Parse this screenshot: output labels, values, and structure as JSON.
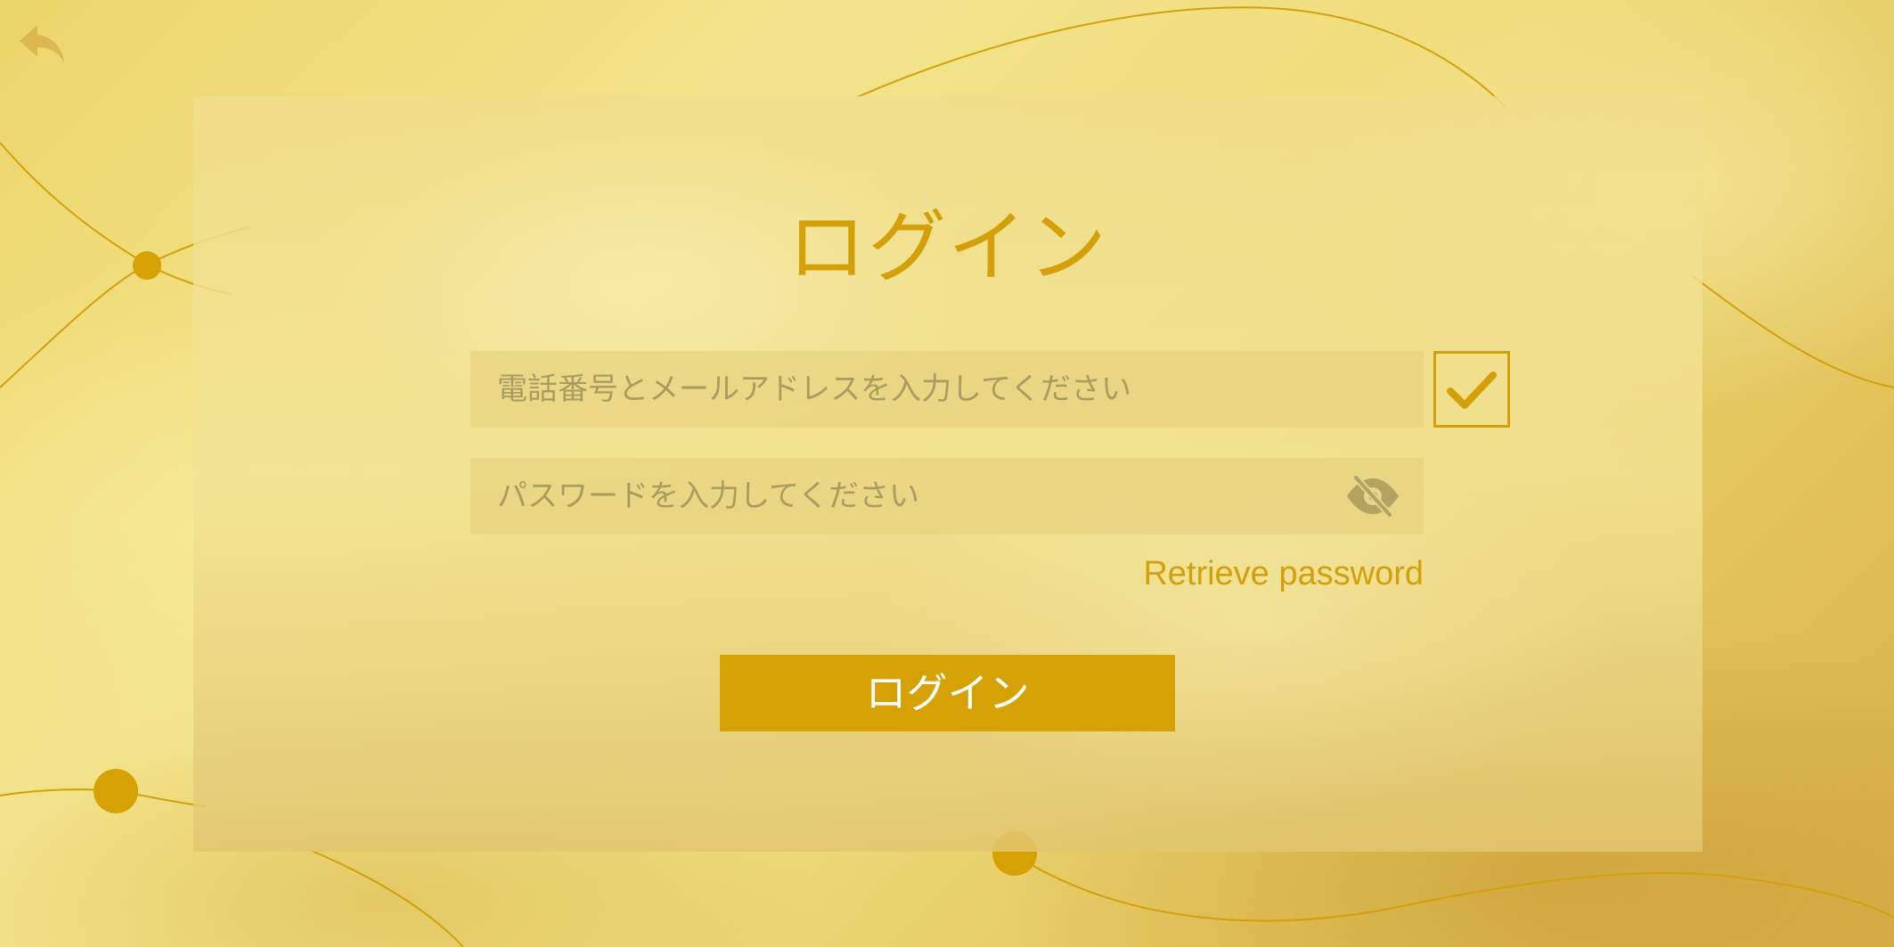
{
  "theme": {
    "accent_color": "#d4a00a",
    "button_color": "#d6a105",
    "button_text_color": "#ffffff"
  },
  "nav": {
    "back_icon": "back-arrow-icon"
  },
  "login": {
    "title": "ログイン",
    "account_placeholder": "電話番号とメールアドレスを入力してください",
    "account_value": "",
    "remember_checked": true,
    "remember_icon": "checkmark-icon",
    "password_placeholder": "パスワードを入力してください",
    "password_value": "",
    "visibility_icon": "eye-slash-icon",
    "retrieve_password_label": "Retrieve password",
    "submit_label": "ログイン"
  }
}
